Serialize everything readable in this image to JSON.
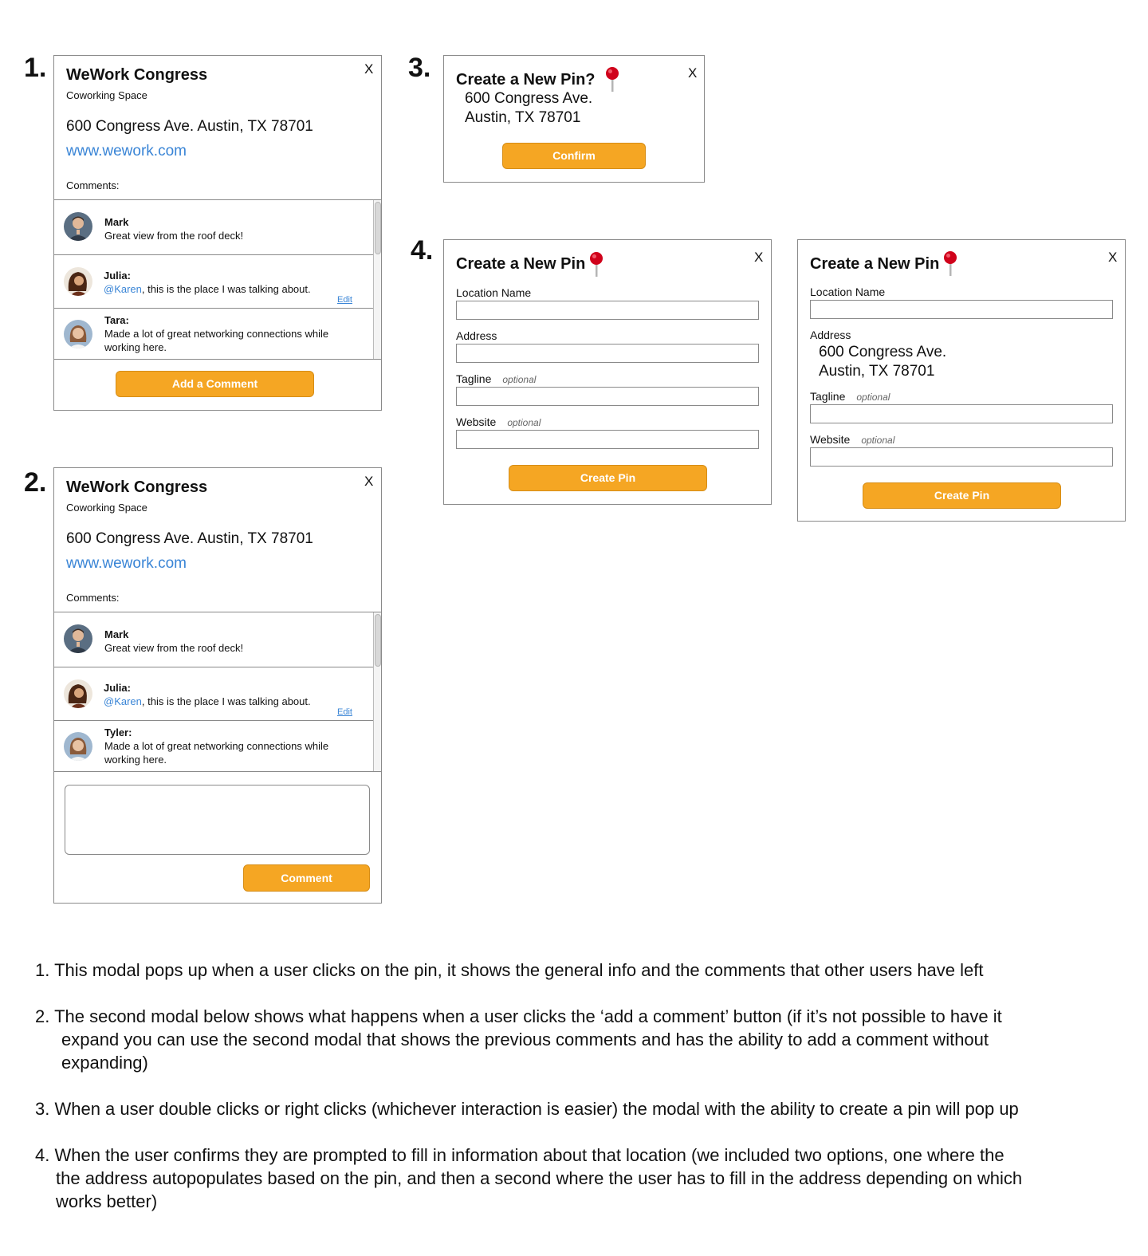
{
  "step_numbers": [
    "1.",
    "2.",
    "3.",
    "4."
  ],
  "modal1": {
    "close": "X",
    "title": "WeWork Congress",
    "subtitle": "Coworking Space",
    "address": "600 Congress Ave. Austin, TX 78701",
    "website": "www.wework.com",
    "comments_label": "Comments:",
    "comments": [
      {
        "name": "Mark",
        "text": "Great view from the roof deck!"
      },
      {
        "name": "Julia:",
        "mention": "@Karen",
        "text": ", this is the place I was talking about.",
        "edit": "Edit"
      },
      {
        "name": "Tara:",
        "text": "Made a lot of great networking connections while working here."
      }
    ],
    "button": "Add a Comment"
  },
  "modal2": {
    "close": "X",
    "title": "WeWork Congress",
    "subtitle": "Coworking Space",
    "address": "600 Congress Ave. Austin, TX 78701",
    "website": "www.wework.com",
    "comments_label": "Comments:",
    "comments": [
      {
        "name": "Mark",
        "text": "Great view from the roof deck!"
      },
      {
        "name": "Julia:",
        "mention": "@Karen",
        "text": ", this is the place I was talking about.",
        "edit": "Edit"
      },
      {
        "name": "Tyler:",
        "text": "Made a lot of great networking connections while working here."
      }
    ],
    "comment_input_value": "",
    "button": "Comment"
  },
  "modal3": {
    "close": "X",
    "title": "Create a New Pin?",
    "address_line1": "600 Congress Ave.",
    "address_line2": "Austin, TX 78701",
    "button": "Confirm"
  },
  "modal4a": {
    "close": "X",
    "title": "Create a New Pin",
    "fields": [
      {
        "label": "Location Name",
        "optional": ""
      },
      {
        "label": "Address",
        "optional": ""
      },
      {
        "label": "Tagline",
        "optional": "optional"
      },
      {
        "label": "Website",
        "optional": "optional"
      }
    ],
    "button": "Create Pin"
  },
  "modal4b": {
    "close": "X",
    "title": "Create a New Pin",
    "location_label": "Location Name",
    "address_label": "Address",
    "address_line1": "600 Congress Ave.",
    "address_line2": "Austin, TX 78701",
    "tagline_label": "Tagline",
    "website_label": "Website",
    "optional": "optional",
    "button": "Create Pin"
  },
  "notes": [
    "1. This modal pops up when a user clicks on the pin, it shows the general info and the comments that other users have left",
    "2. The second modal below shows what happens when a user clicks the ‘add a comment’ button (if it’s not possible to have it",
    "expand you can use the second modal that shows the previous comments and has the ability to add a comment without",
    "expanding)",
    "3. When a user double clicks or right clicks (whichever interaction is easier) the modal with the ability to create a pin will pop up",
    "4. When the user confirms they are prompted to fill in information about that location (we included two options, one where the",
    "the address autopopulates based on the pin, and then a second where the user has to fill in the address depending on which",
    "works better)"
  ],
  "colors": {
    "accent": "#f5a623",
    "link": "#3a85d6",
    "pin": "#d0021b",
    "border": "#8a8a8a"
  },
  "icons": {
    "pin": "map-pin-icon",
    "avatar": "user-avatar"
  }
}
